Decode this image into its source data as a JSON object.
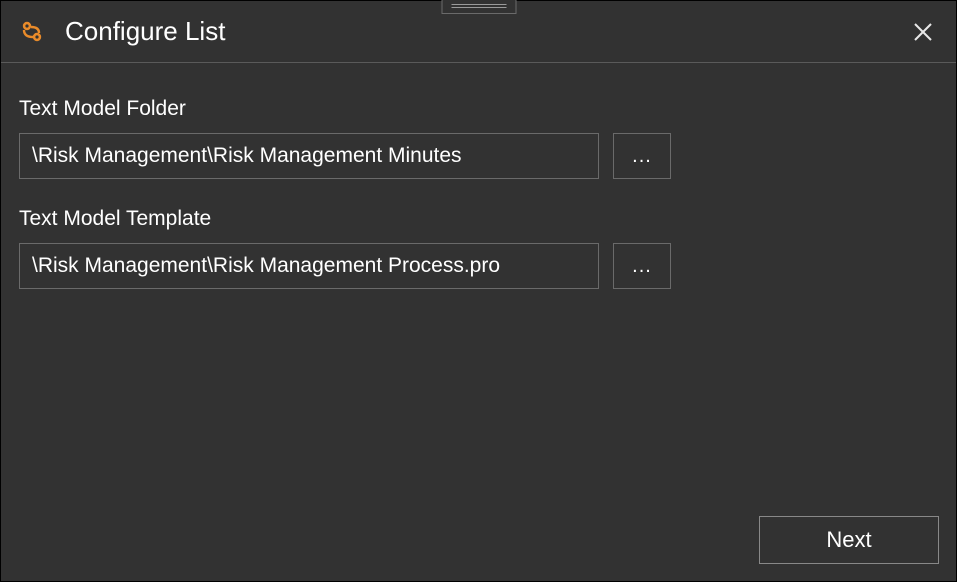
{
  "header": {
    "title": "Configure List"
  },
  "fields": {
    "folder": {
      "label": "Text Model Folder",
      "value": "\\Risk Management\\Risk Management Minutes",
      "browse": "..."
    },
    "template": {
      "label": "Text Model Template",
      "value": "\\Risk Management\\Risk Management Process.pro",
      "browse": "..."
    }
  },
  "footer": {
    "next": "Next"
  }
}
